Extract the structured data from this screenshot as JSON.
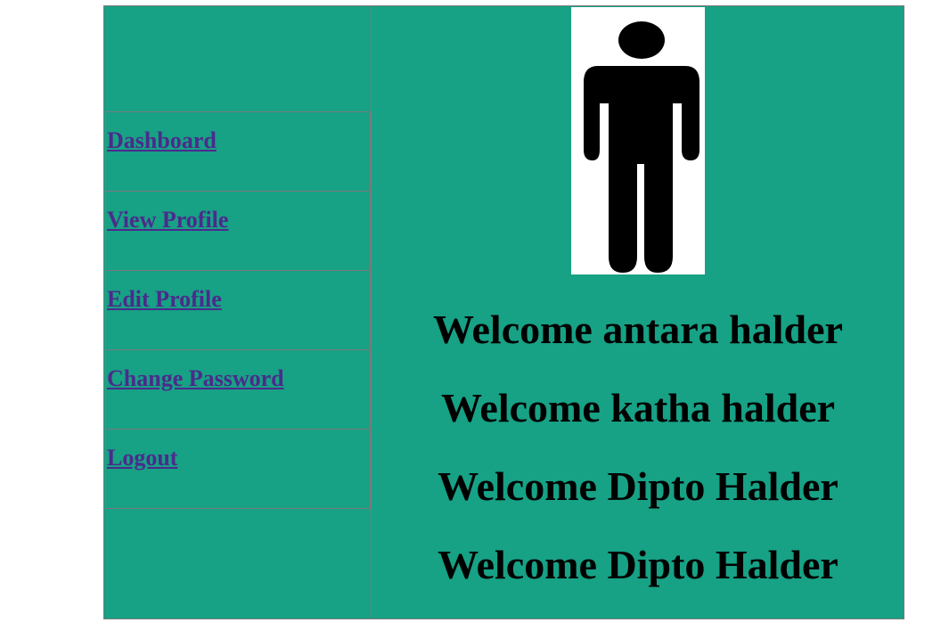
{
  "nav": {
    "items": [
      {
        "label": "Dashboard"
      },
      {
        "label": "View Profile"
      },
      {
        "label": "Edit Profile"
      },
      {
        "label": "Change Password"
      },
      {
        "label": "Logout"
      }
    ]
  },
  "avatar": {
    "icon": "person-silhouette-icon"
  },
  "welcome_messages": [
    "Welcome antara halder",
    "Welcome katha halder",
    "Welcome Dipto Halder",
    "Welcome Dipto Halder"
  ],
  "colors": {
    "background": "#17a185",
    "link": "#4b2b8c",
    "border": "#7a7a7a"
  }
}
